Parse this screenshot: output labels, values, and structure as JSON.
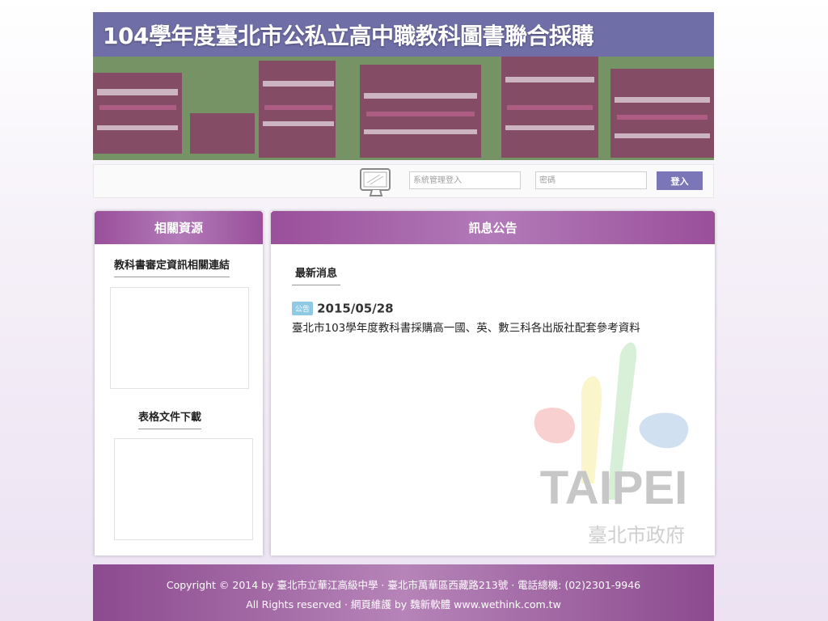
{
  "banner": {
    "title": "104學年度臺北市公私立高中職教科圖書聯合採購"
  },
  "login": {
    "username_placeholder": "系統管理登入",
    "password_placeholder": "密碼",
    "submit_label": "登入"
  },
  "left_panel": {
    "heading": "相關資源",
    "section1_title": "教科書審定資訊相關連結",
    "section2_title": "表格文件下載"
  },
  "right_panel": {
    "heading": "訊息公告",
    "tab_label": "最新消息",
    "news": [
      {
        "badge": "公告",
        "date": "2015/05/28",
        "title": "臺北市103學年度教科書採購高一國、英、數三科各出版社配套參考資料"
      }
    ]
  },
  "logo": {
    "word": "TAIPEI",
    "subtitle": "臺北市政府"
  },
  "footer": {
    "line1": "Copyright © 2014 by 臺北市立華江高級中學 · 臺北市萬華區西藏路213號 · 電話總機: (02)2301-9946",
    "line2": "All Rights reserved · 網頁維護 by 魏新軟體 www.wethink.com.tw"
  },
  "colors": {
    "accent": "#9a4f9a",
    "button": "#7b76b8",
    "badge": "#8ec9e6"
  }
}
